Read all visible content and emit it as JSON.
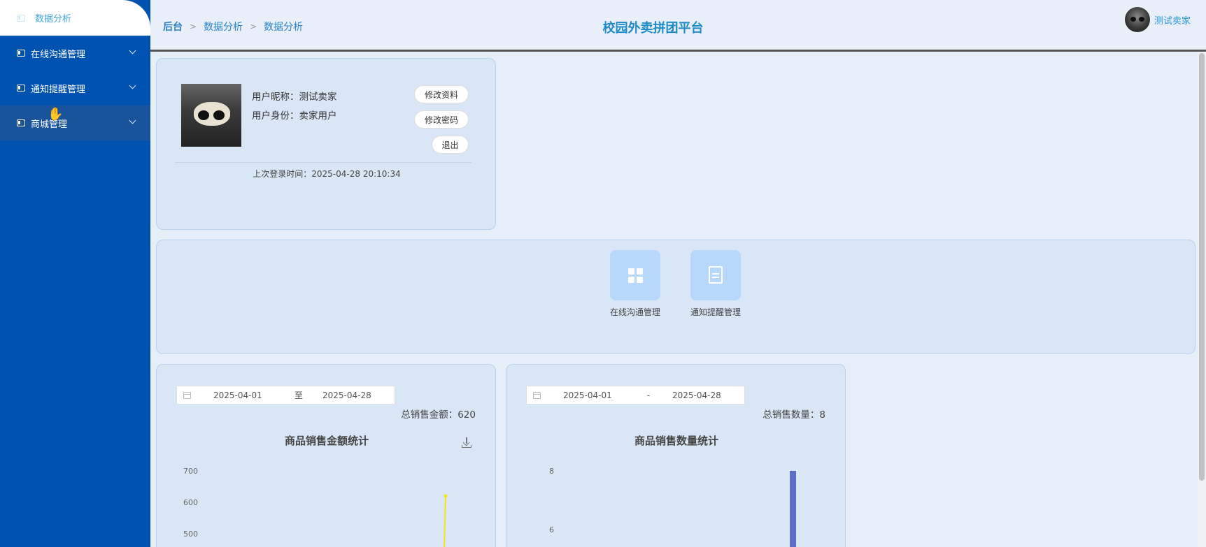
{
  "sidebar": {
    "top_label": "数据分析",
    "items": [
      {
        "label": "在线沟通管理"
      },
      {
        "label": "通知提醒管理"
      },
      {
        "label": "商城管理"
      }
    ]
  },
  "header": {
    "breadcrumb": [
      "后台",
      "数据分析",
      "数据分析"
    ],
    "title": "校园外卖拼团平台",
    "user_name": "测试卖家"
  },
  "profile": {
    "nickname": "用户昵称：测试卖家",
    "role": "用户身份：卖家用户",
    "edit_profile": "修改资料",
    "change_password": "修改密码",
    "logout": "退出",
    "last_login": "上次登录时间：2025-04-28 20:10:34"
  },
  "quick_links": [
    {
      "label": "在线沟通管理",
      "icon": "grid-icon"
    },
    {
      "label": "通知提醒管理",
      "icon": "document-icon"
    }
  ],
  "charts": {
    "amount": {
      "start_date": "2025-04-01",
      "separator": "至",
      "end_date": "2025-04-28",
      "total": "总销售金额：620",
      "title": "商品销售金额统计"
    },
    "quantity": {
      "start_date": "2025-04-01",
      "separator": "-",
      "end_date": "2025-04-28",
      "total": "总销售数量：8",
      "title": "商品销售数量统计"
    }
  },
  "colors": {
    "sidebar": "#0052b0",
    "accent": "#1f8bc8",
    "line_series": "#f5e61a",
    "bar_series": "#5b6fc7"
  },
  "chart_data": [
    {
      "type": "line",
      "title": "商品销售金额统计",
      "yticks": [
        700,
        600,
        500
      ],
      "ylim": [
        0,
        700
      ],
      "series": [
        {
          "values": [
            620
          ]
        }
      ]
    },
    {
      "type": "bar",
      "title": "商品销售数量统计",
      "yticks": [
        8,
        6
      ],
      "ylim": [
        0,
        8
      ],
      "series": [
        {
          "values": [
            8
          ]
        }
      ]
    }
  ]
}
